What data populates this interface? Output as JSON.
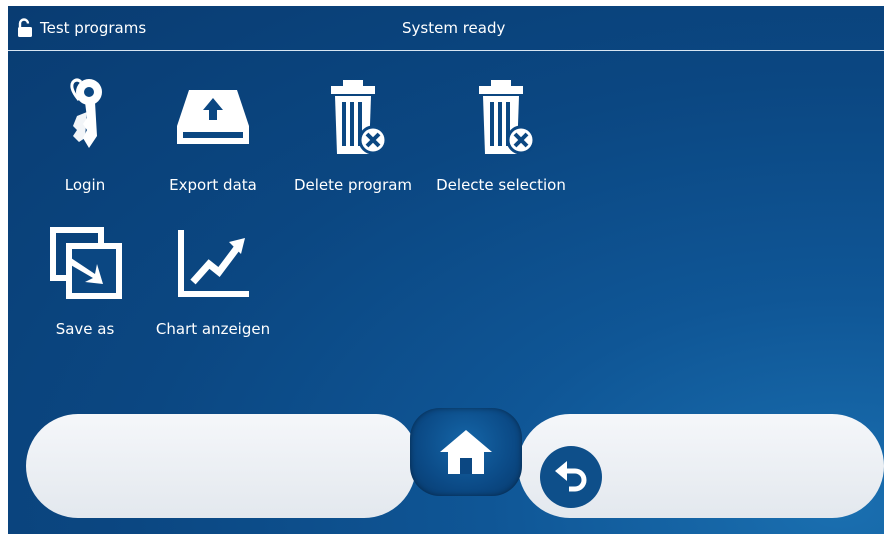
{
  "topbar": {
    "title": "Test programs",
    "status": "System ready"
  },
  "tiles": [
    {
      "label": "Login",
      "icon": "keys-icon"
    },
    {
      "label": "Export data",
      "icon": "drive-upload-icon"
    },
    {
      "label": "Delete program",
      "icon": "trash-delete-icon"
    },
    {
      "label": "Delecte selection",
      "icon": "trash-delete-icon"
    },
    {
      "label": "Save as",
      "icon": "save-as-icon"
    },
    {
      "label": "Chart anzeigen",
      "icon": "chart-trend-icon"
    }
  ],
  "nav": {
    "home_icon": "home-icon",
    "back_icon": "back-arrow-icon"
  },
  "colors": {
    "background": "#0b4782",
    "text": "#ffffff",
    "nav_pill": "#eef1f5",
    "button_blue": "#0e4f8a"
  }
}
